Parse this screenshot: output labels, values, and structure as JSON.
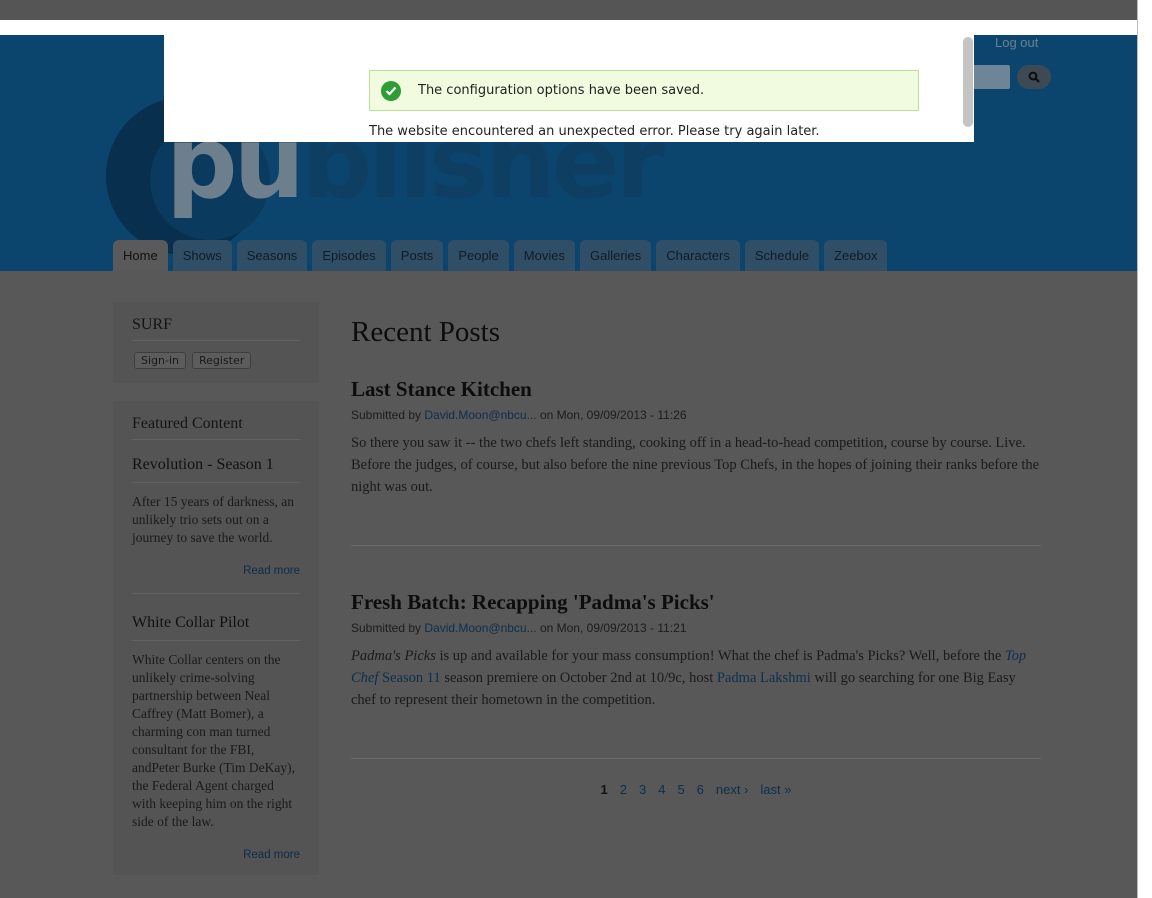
{
  "header": {
    "site_name_lead": "pu",
    "site_name_rest": "blisher",
    "logout_label": "Log out"
  },
  "tabs": [
    {
      "label": "Home"
    },
    {
      "label": "Shows"
    },
    {
      "label": "Seasons"
    },
    {
      "label": "Episodes"
    },
    {
      "label": "Posts"
    },
    {
      "label": "People"
    },
    {
      "label": "Movies"
    },
    {
      "label": "Galleries"
    },
    {
      "label": "Characters"
    },
    {
      "label": "Schedule"
    },
    {
      "label": "Zeebox"
    }
  ],
  "sidebar": {
    "surf": {
      "title": "SURF",
      "signin_label": "Sign-in",
      "register_label": "Register"
    },
    "featured": {
      "title": "Featured Content",
      "items": [
        {
          "title": "Revolution - Season 1",
          "body": "After 15 years of darkness, an unlikely trio sets out on a journey to save the world.",
          "read_more": "Read more"
        },
        {
          "title": "White Collar Pilot",
          "body": "White Collar centers on the unlikely crime-solving partnership between Neal Caffrey (Matt Bomer), a charming con man turned consultant for the FBI, andPeter Burke (Tim DeKay), the Federal Agent charged with keeping him on the right side of the law.",
          "read_more": "Read more"
        }
      ]
    }
  },
  "main": {
    "page_title": "Recent Posts",
    "posts": [
      {
        "title": "Last Stance Kitchen",
        "submitted_by": "Submitted by ",
        "author": "David.Moon@nbcu...",
        "date_text": " on Mon, 09/09/2013 - 11:26",
        "body": "So there you saw it -- the two chefs left standing, cooking off in a head-to-head competition, course by course. Live. Before the judges, of course, but also before the nine previous Top Chefs, in the hopes of joining their ranks before the night was out."
      },
      {
        "title": "Fresh Batch: Recapping 'Padma's Picks'",
        "submitted_by": "Submitted by ",
        "author": "David.Moon@nbcu...",
        "date_text": " on Mon, 09/09/2013 - 11:21",
        "body_part1_em": "Padma's Picks",
        "body_part2": " is up and available for your mass consumption! What the chef is Padma's Picks? Well, before the ",
        "body_link1_em": "Top Chef",
        "body_link1_rest": " Season 11",
        "body_part3": " season premiere on October 2nd at 10/9c, host ",
        "body_link2": "Padma Lakshmi",
        "body_part4": " will go searching for one Big Easy chef to represent their hometown in the competition."
      }
    ],
    "pager": {
      "current": "1",
      "pages": [
        "2",
        "3",
        "4",
        "5",
        "6"
      ],
      "next": "next ›",
      "last": "last »"
    }
  },
  "dialog": {
    "status_message": "The configuration options have been saved.",
    "error_message": "The website encountered an unexpected error. Please try again later."
  }
}
